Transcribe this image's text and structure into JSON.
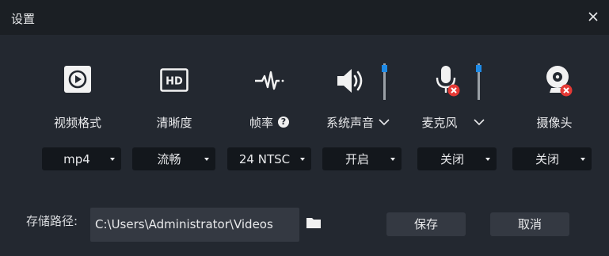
{
  "window": {
    "title": "设置"
  },
  "items": [
    {
      "icon": "video-format-icon",
      "label": "视频格式",
      "value": "mp4"
    },
    {
      "icon": "hd-icon",
      "label": "清晰度",
      "value": "流畅"
    },
    {
      "icon": "waveform-icon",
      "label": "帧率",
      "value": "24 NTSC"
    },
    {
      "icon": "speaker-icon",
      "label": "系统声音",
      "value": "开启"
    },
    {
      "icon": "microphone-muted-icon",
      "label": "麦克风",
      "value": "关闭"
    },
    {
      "icon": "webcam-muted-icon",
      "label": "摄像头",
      "value": "关闭"
    }
  ],
  "volume": {
    "system_sound_level": 0.9,
    "microphone_level": 0.9
  },
  "save_path": {
    "label": "存储路径:",
    "value": "C:\\Users\\Administrator\\Videos"
  },
  "buttons": {
    "save": "保存",
    "cancel": "取消"
  },
  "colors": {
    "accent": "#1e8ae6",
    "muted_badge": "#e53935",
    "background": "#232830",
    "titlebar": "#1b1f24"
  }
}
